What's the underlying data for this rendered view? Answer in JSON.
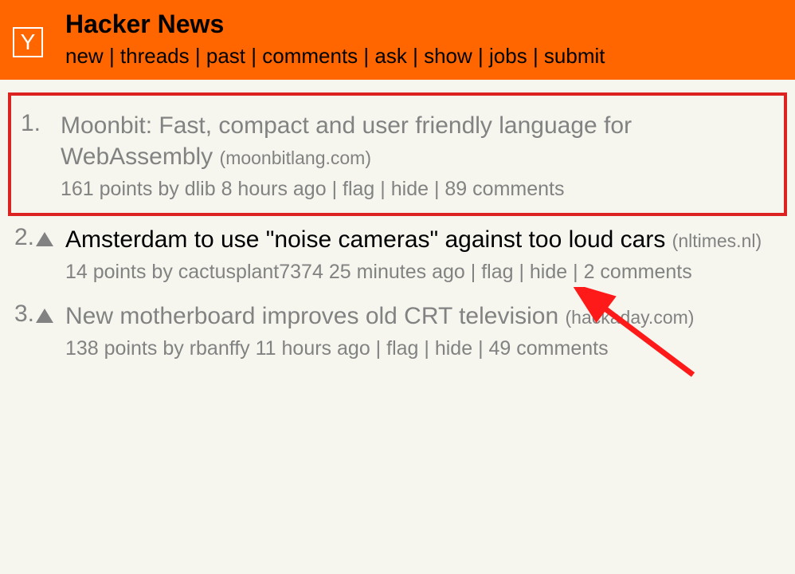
{
  "header": {
    "logo_letter": "Y",
    "title": "Hacker News",
    "nav": [
      "new",
      "threads",
      "past",
      "comments",
      "ask",
      "show",
      "jobs",
      "submit"
    ]
  },
  "stories": [
    {
      "rank": "1.",
      "title": "Moonbit: Fast, compact and user friendly language for WebAssembly",
      "domain": "(moonbitlang.com)",
      "points": "161 points",
      "by_prefix": "by",
      "author": "dlib",
      "age": "8 hours ago",
      "flag": "flag",
      "hide": "hide",
      "comments": "89 comments",
      "highlighted": true,
      "show_upvote": false,
      "title_color": "visited"
    },
    {
      "rank": "2.",
      "title": "Amsterdam to use \"noise cameras\" against too loud cars",
      "domain": "(nltimes.nl)",
      "points": "14 points",
      "by_prefix": "by",
      "author": "cactusplant7374",
      "age": "25 minutes ago",
      "flag": "flag",
      "hide": "hide",
      "comments": "2 comments",
      "highlighted": false,
      "show_upvote": true,
      "title_color": "normal"
    },
    {
      "rank": "3.",
      "title": "New motherboard improves old CRT television",
      "domain": "(hackaday.com)",
      "points": "138 points",
      "by_prefix": "by",
      "author": "rbanffy",
      "age": "11 hours ago",
      "flag": "flag",
      "hide": "hide",
      "comments": "49 comments",
      "highlighted": false,
      "show_upvote": true,
      "title_color": "visited"
    }
  ]
}
